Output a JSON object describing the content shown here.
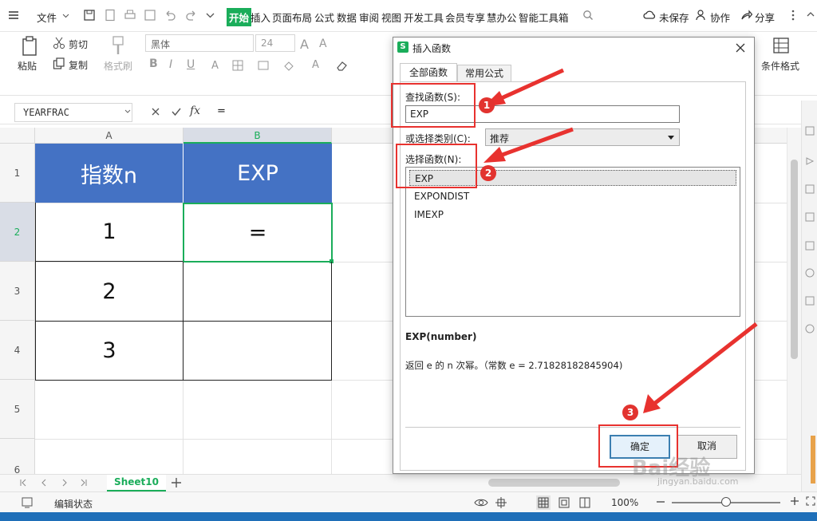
{
  "menubar": {
    "file": "文件",
    "tabs": [
      "开始",
      "插入",
      "页面布局",
      "公式",
      "数据",
      "审阅",
      "视图",
      "开发工具",
      "会员专享",
      "慧办公",
      "智能工具箱"
    ],
    "unsaved": "未保存",
    "collab": "协作",
    "share": "分享"
  },
  "ribbon": {
    "paste": "粘贴",
    "cut": "剪切",
    "copy": "复制",
    "format_painter": "格式刷",
    "font_name": "黑体",
    "font_size": "24",
    "bold": "B",
    "conditional_format": "条件格式"
  },
  "formula_bar": {
    "name_box": "YEARFRAC",
    "fx": "fx",
    "content": "="
  },
  "grid": {
    "col_headers": [
      "A",
      "B"
    ],
    "row_headers": [
      "1",
      "2",
      "3",
      "4",
      "5",
      "6"
    ],
    "cells": {
      "a1": "指数n",
      "b1": "EXP",
      "a2": "1",
      "b2": "=",
      "a3": "2",
      "a4": "3"
    }
  },
  "sheet_tab": "Sheet10",
  "status": {
    "mode": "编辑状态",
    "zoom": "100%"
  },
  "dialog": {
    "title": "插入函数",
    "tab_all": "全部函数",
    "tab_common": "常用公式",
    "search_label": "查找函数(S):",
    "search_value": "EXP",
    "category_label": "或选择类别(C):",
    "category_value": "推荐",
    "select_label": "选择函数(N):",
    "functions": [
      "EXP",
      "EXPONDIST",
      "IMEXP"
    ],
    "signature": "EXP(number)",
    "description": "返回 e 的 n 次幂。（常数 e = 2.71828182845904)",
    "ok": "确定",
    "cancel": "取消"
  },
  "annotations": {
    "badge1": "1",
    "badge2": "2",
    "badge3": "3"
  },
  "watermark": {
    "brand": "Bai经验",
    "url": "jingyan.baidu.com"
  },
  "colors": {
    "header_fill": "#4472c4",
    "accent_green": "#1aad5a",
    "annotation_red": "#e8322f"
  }
}
